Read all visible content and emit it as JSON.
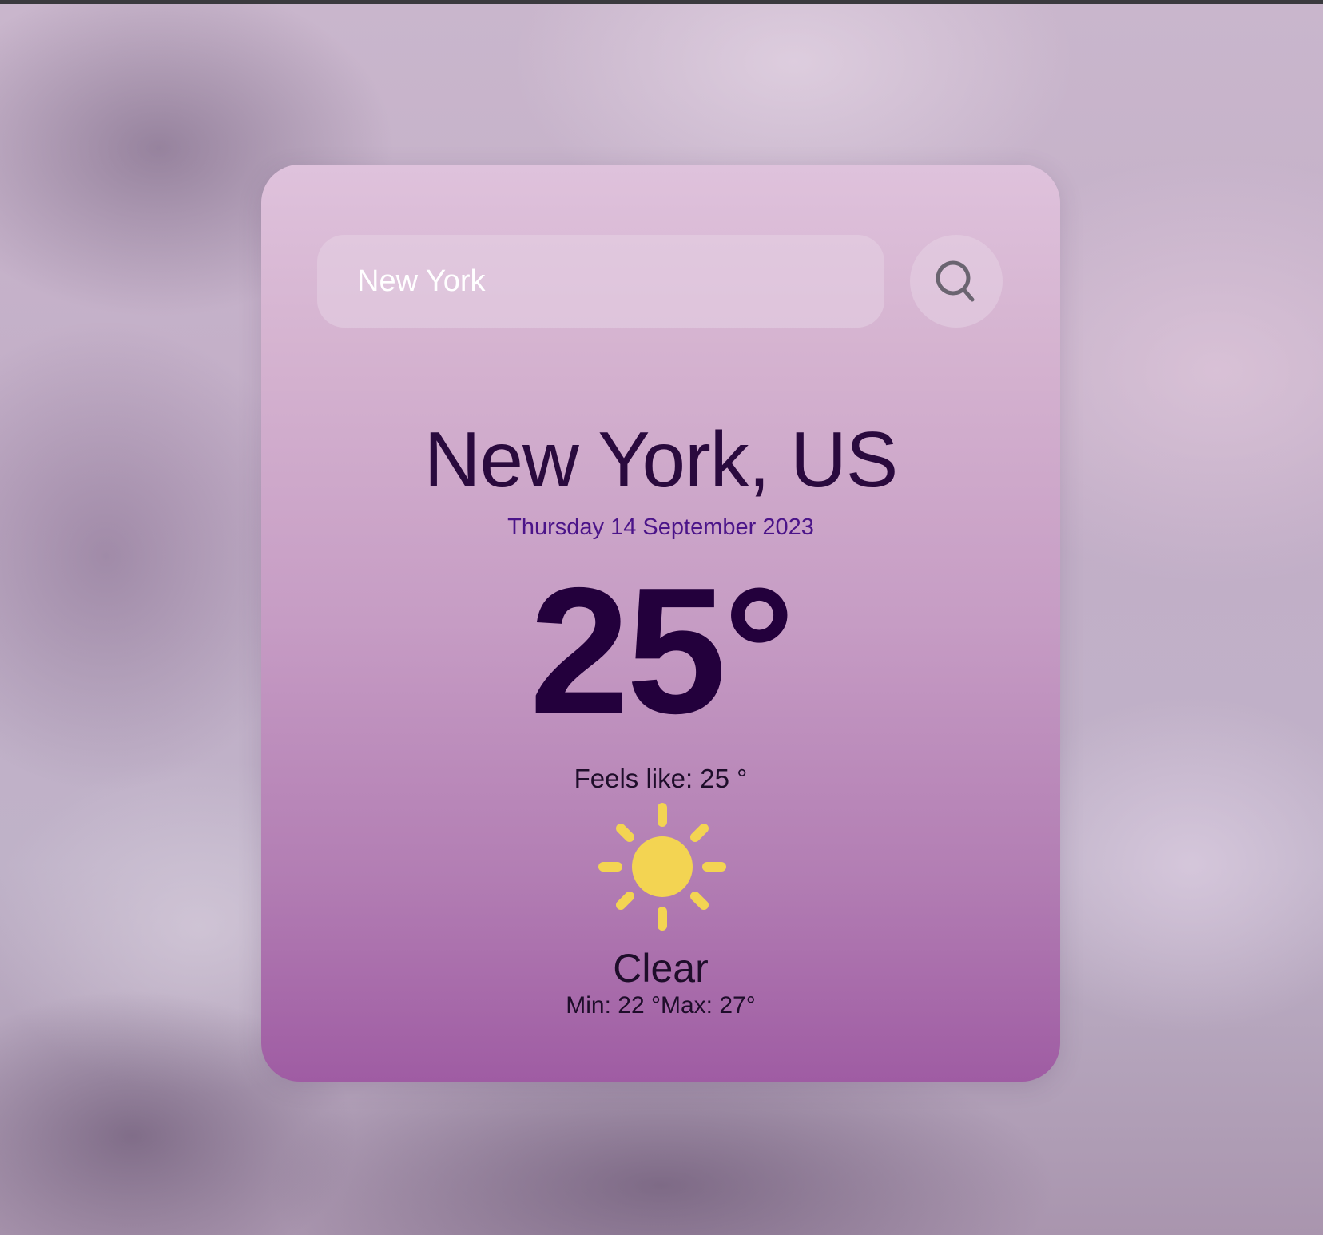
{
  "search": {
    "value": "New York",
    "icon": "search-icon"
  },
  "weather": {
    "location": "New York, US",
    "date": "Thursday 14 September 2023",
    "temperature": "25°",
    "feels_like": "Feels like: 25 °",
    "condition_icon": "sun-icon",
    "condition": "Clear",
    "min_max": "Min: 22 °Max: 27°"
  },
  "colors": {
    "card_top": "#dfc2dc",
    "card_bottom": "#9f5ca3",
    "temperature": "#23003c",
    "date": "#4b1489",
    "sun": "#f3d452"
  }
}
